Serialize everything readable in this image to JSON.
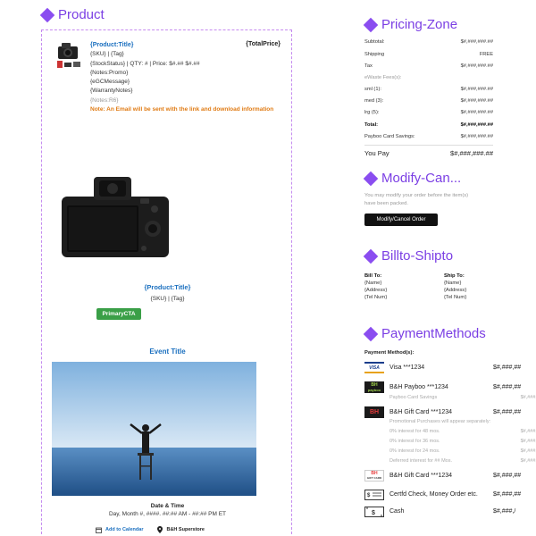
{
  "product": {
    "heading": "Product",
    "cart": {
      "title": "{Product:Title}",
      "total_price": "{TotalPrice}",
      "sku_tag": "{SKU}  |  {Tag}",
      "stock_line": "{StockStatus}  |  QTY: # | Price: $#.## $#.##",
      "notes_promo": "{Notes:Promo}",
      "egc_message": "{eGCMessage}",
      "warranty_notes": "{WarrantyNotes}",
      "notes_r6": "{Notes:R6}",
      "email_note": "Note: An Email will be sent with the link and download information"
    },
    "item2": {
      "title": "{Product:Title}",
      "sku_tag": "{SKU}  |  {Tag}",
      "cta": "PrimaryCTA"
    },
    "event": {
      "title": "Event Title",
      "date_label": "Date & Time",
      "date_value": "Day, Month #, ####. ##:## AM - ##:## PM ET",
      "calendar_link": "Add to Calendar",
      "store": "B&H Superstore"
    }
  },
  "pricing": {
    "heading": "Pricing-Zone",
    "rows": [
      {
        "label": "Subtotal:",
        "value": "$#,###,###.##"
      },
      {
        "label": "Shipping",
        "value": "FREE"
      },
      {
        "label": "Tax",
        "value": "$#,###,###.##"
      },
      {
        "label": "eWaste Fees(s):",
        "value": ""
      },
      {
        "label": "sml (1):",
        "value": "$#,###,###.##"
      },
      {
        "label": "med (3):",
        "value": "$#,###,###.##"
      },
      {
        "label": "lrg (5):",
        "value": "$#,###,###.##"
      },
      {
        "label": "Total:",
        "value": "$#,###,###.##"
      },
      {
        "label": "Payboo Card Savings:",
        "value": "$#,###,###.##"
      }
    ],
    "you_pay_label": "You Pay",
    "you_pay_value": "$#,###,###.##"
  },
  "modify": {
    "heading": "Modify-Can...",
    "text": "You may modify your order before the item(s) have been packed.",
    "button": "Modify/Cancel Order"
  },
  "billto": {
    "heading": "Billto-Shipto",
    "bill_label": "Bill To:",
    "bill_name": "{Name}",
    "bill_address": "{Address}",
    "bill_tel": "{Tel Num}",
    "ship_label": "Ship To:",
    "ship_name": "{Name}",
    "ship_address": "{Address}",
    "ship_tel": "{Tel Num}"
  },
  "payment": {
    "heading": "PaymentMethods",
    "label": "Payment Method(s):",
    "visa_name": "Visa ***1234",
    "visa_amt": "$#,###,##",
    "payboo_name": "B&H Payboo ***1234",
    "payboo_amt": "$#,###,##",
    "payboo_sub_label": "Payboo Card Savings",
    "payboo_sub_amt": "$#,###,#",
    "gift1_name": "B&H Gift Card ***1234",
    "gift1_amt": "$#,###,##",
    "promo_text": "Promotional Purchases will appear separately:",
    "interest": [
      {
        "label": "0% interest for 48 mos.",
        "amt": "$#,###,#"
      },
      {
        "label": "0% interest for 36 mos.",
        "amt": "$#,###,#"
      },
      {
        "label": "0% interest for 24 mos.",
        "amt": "$#,###,#"
      },
      {
        "label": "Deferred interest for ## Mos.",
        "amt": "$#,###,#"
      }
    ],
    "gift2_name": "B&H Gift Card ***1234",
    "gift2_amt": "$#,###,##",
    "check_name": "Certfd Check, Money Order etc.",
    "check_amt": "$#,###,##",
    "cash_name": "Cash",
    "cash_amt": "$#,###,/",
    "logo_visa": "VISA",
    "logo_bh": "BH",
    "logo_payboo": "payboo",
    "logo_giftcard": "GIFT CARD"
  },
  "colors": {
    "accent": "#7b3fe4",
    "link": "#1a6fbf",
    "cta": "#3a9f47",
    "warning": "#e07b14"
  }
}
